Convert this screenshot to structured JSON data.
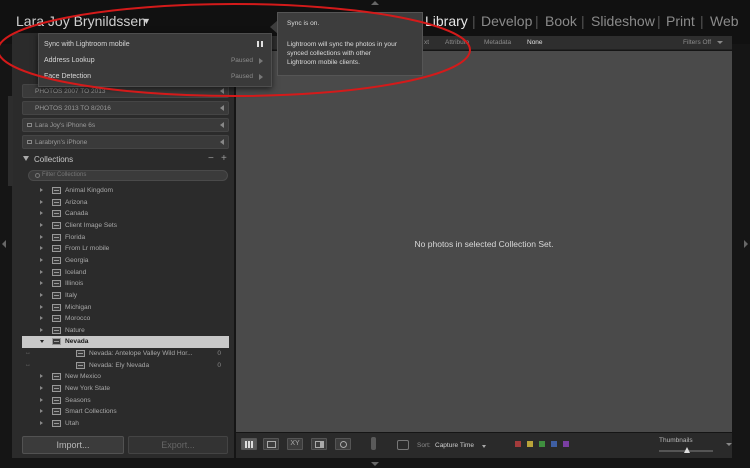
{
  "identity": {
    "name": "Lara Joy Brynildssen",
    "caret": "▼"
  },
  "modules": [
    {
      "label": "Library",
      "active": true
    },
    {
      "label": "Develop",
      "active": false
    },
    {
      "label": "Book",
      "active": false
    },
    {
      "label": "Slideshow",
      "active": false
    },
    {
      "label": "Print",
      "active": false
    },
    {
      "label": "Web",
      "active": false
    }
  ],
  "module_separator": "|",
  "sync_popup": {
    "rows": [
      {
        "label": "Sync with Lightroom mobile",
        "status": ""
      },
      {
        "label": "Address Lookup",
        "status": "Paused"
      },
      {
        "label": "Face Detection",
        "status": "Paused"
      }
    ]
  },
  "tooltip": {
    "line1": "Sync is on.",
    "line2": "Lightroom will sync the photos in your",
    "line3": "synced collections with other",
    "line4": "Lightroom mobile clients."
  },
  "folders": [
    {
      "label": "PHOTOS 2007 TO 2013"
    },
    {
      "label": "PHOTOS 2013 TO 8/2016"
    },
    {
      "label": "Lara Joy's iPhone 6s"
    },
    {
      "label": "Larabryn's iPhone"
    }
  ],
  "collections": {
    "title": "Collections",
    "minus": "−",
    "plus": "+",
    "filter_placeholder": "Filter Collections",
    "items": [
      {
        "label": "Animal Kingdom",
        "count": ""
      },
      {
        "label": "Arizona",
        "count": ""
      },
      {
        "label": "Canada",
        "count": ""
      },
      {
        "label": "Client Image Sets",
        "count": ""
      },
      {
        "label": "Florida",
        "count": ""
      },
      {
        "label": "From Lr mobile",
        "count": ""
      },
      {
        "label": "Georgia",
        "count": ""
      },
      {
        "label": "Iceland",
        "count": ""
      },
      {
        "label": "Illinois",
        "count": ""
      },
      {
        "label": "Italy",
        "count": ""
      },
      {
        "label": "Michigan",
        "count": ""
      },
      {
        "label": "Morocco",
        "count": ""
      },
      {
        "label": "Nature",
        "count": ""
      },
      {
        "label": "Nevada",
        "count": ""
      },
      {
        "label": "Nevada: Antelope Valley Wild Hor...",
        "count": "0"
      },
      {
        "label": "Nevada: Ely Nevada",
        "count": "0"
      },
      {
        "label": "New Mexico",
        "count": ""
      },
      {
        "label": "New York State",
        "count": ""
      },
      {
        "label": "Seasons",
        "count": ""
      },
      {
        "label": "Smart Collections",
        "count": ""
      },
      {
        "label": "Utah",
        "count": ""
      }
    ]
  },
  "buttons": {
    "import": "Import...",
    "export": "Export..."
  },
  "filter_bar": {
    "items": [
      "xt",
      "Attribute",
      "Metadata",
      "None"
    ],
    "filters_off": "Filters Off"
  },
  "main": {
    "empty_message": "No photos in selected Collection Set."
  },
  "toolbar": {
    "sort_label": "Sort:",
    "sort_value": "Capture Time",
    "thumbnails_label": "Thumbnails",
    "swatches": [
      "#a33b3b",
      "#b9a33a",
      "#3f8f3f",
      "#3f5fa3",
      "#7a3fa3"
    ]
  },
  "colors": {
    "annotation": "#d41a1a",
    "selected_row": "#c8c8c8",
    "grid_bg": "#4a4a4a"
  }
}
